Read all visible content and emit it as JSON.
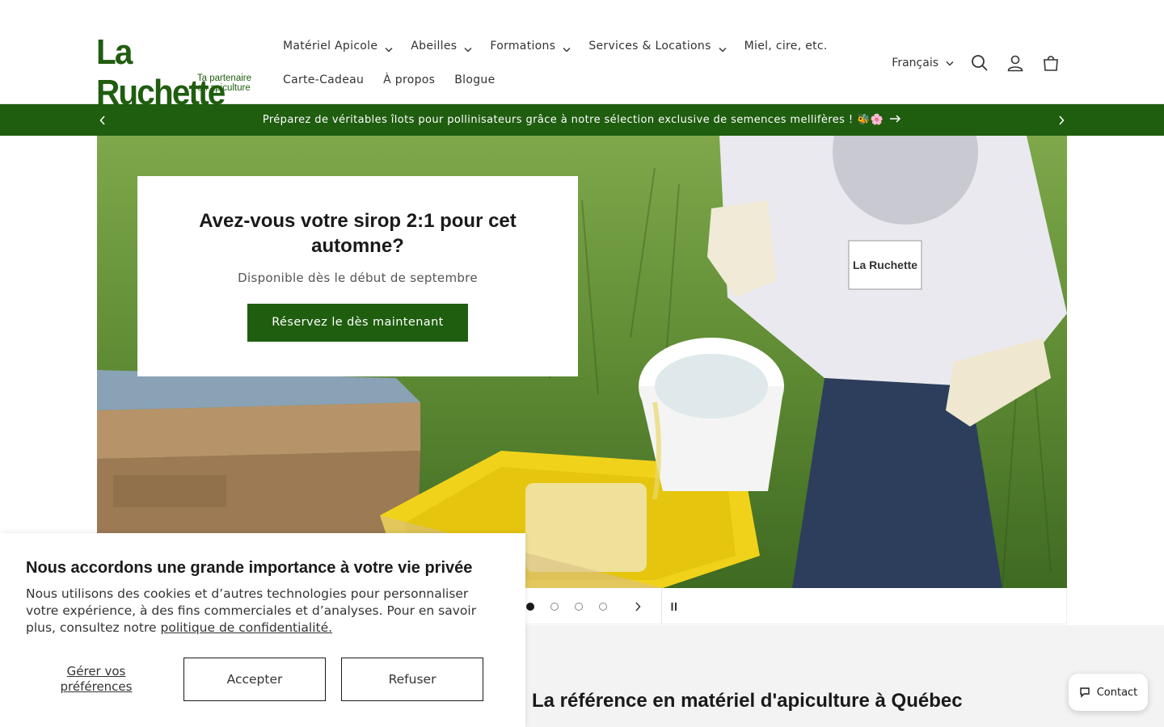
{
  "logo": {
    "name": "La Ruchette",
    "tagline_line1": "Ta partenaire",
    "tagline_line2": "en apiculture"
  },
  "nav": {
    "row1": [
      {
        "label": "Matériel Apicole",
        "dropdown": true
      },
      {
        "label": "Abeilles",
        "dropdown": true
      },
      {
        "label": "Formations",
        "dropdown": true
      },
      {
        "label": "Services & Locations",
        "dropdown": true
      },
      {
        "label": "Miel, cire, etc.",
        "dropdown": false
      }
    ],
    "row2": [
      {
        "label": "Carte-Cadeau",
        "dropdown": false
      },
      {
        "label": "À propos",
        "dropdown": false
      },
      {
        "label": "Blogue",
        "dropdown": false
      }
    ]
  },
  "header": {
    "language": "Français",
    "icons": [
      "search-icon",
      "account-icon",
      "cart-icon"
    ]
  },
  "announcement": {
    "text": "Préparez de véritables îlots pour pollinisateurs grâce à notre sélection exclusive de semences mellifères ! 🐝🌸"
  },
  "hero": {
    "title": "Avez-vous votre sirop 2:1 pour cet automne?",
    "subtitle": "Disponible dès le début de septembre",
    "button": "Réservez le dès maintenant",
    "bucket_brand": "La Ruchette",
    "slides_total": 4,
    "active_slide": 1
  },
  "section": {
    "title": "La référence en matériel d'apiculture à Québec"
  },
  "cookie": {
    "title": "Nous accordons une grande importance à votre vie privée",
    "text": "Nous utilisons des cookies et d’autres technologies pour personnaliser votre expérience, à des fins commerciales et d’analyses. Pour en savoir plus, consultez notre ",
    "link": "politique de confidentialité.",
    "manage": "Gérer vos préférences",
    "accept": "Accepter",
    "refuse": "Refuser"
  },
  "contact": {
    "label": "Contact"
  },
  "colors": {
    "brand_green": "#1f5d0f",
    "background": "#ffffff",
    "section_bg": "#f3f3f3"
  }
}
